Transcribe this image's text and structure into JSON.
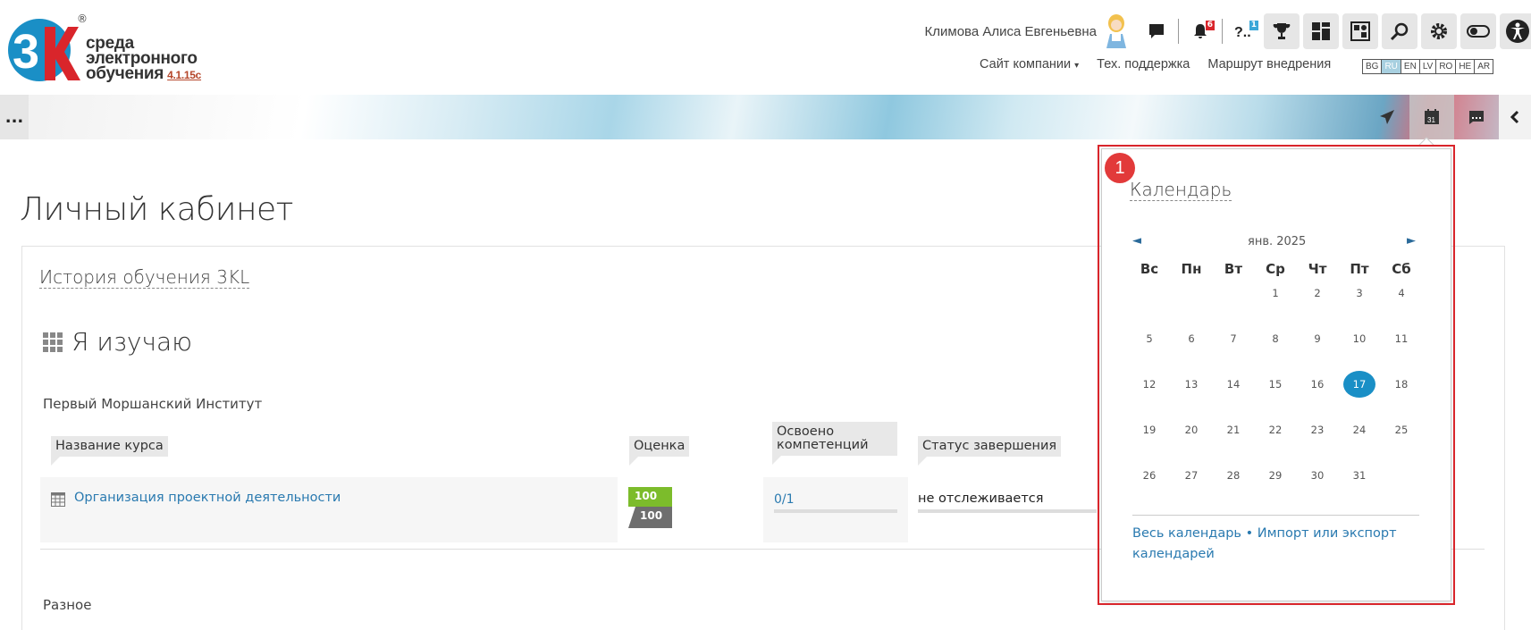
{
  "header": {
    "logo_text_line1": "среда",
    "logo_text_line2": "электронного",
    "logo_text_line3": "обучения",
    "logo_version": "4.1.15c",
    "logo_reg": "®",
    "user_name": "Климова Алиса Евгеньевна",
    "notifications_badge": "6",
    "questions_badge": "1",
    "nav_links": [
      "Сайт компании",
      "Тех. поддержка",
      "Маршрут внедрения"
    ],
    "languages": [
      "BG",
      "RU",
      "EN",
      "LV",
      "RO",
      "HE",
      "AR"
    ],
    "active_language": "RU"
  },
  "banner": {
    "more_label": "..."
  },
  "page": {
    "title": "Личный кабинет",
    "history_link": "История обучения 3KL",
    "studying_heading": "Я изучаю",
    "org_name": "Первый Моршанский Институт",
    "columns": [
      "Название курса",
      "Оценка",
      "Освоено компетенций",
      "Статус завершения"
    ],
    "course": {
      "name": "Организация проектной деятельности",
      "grade": "100",
      "grade_max": "100",
      "competencies": "0/1",
      "status": "не отслеживается"
    },
    "misc_heading": "Разное"
  },
  "calendar": {
    "marker": "1",
    "title": "Календарь",
    "month": "янв. 2025",
    "prev": "◄",
    "next": "►",
    "weekdays": [
      "Вс",
      "Пн",
      "Вт",
      "Ср",
      "Чт",
      "Пт",
      "Сб"
    ],
    "weeks": [
      [
        "",
        "",
        "",
        "1",
        "2",
        "3",
        "4"
      ],
      [
        "5",
        "6",
        "7",
        "8",
        "9",
        "10",
        "11"
      ],
      [
        "12",
        "13",
        "14",
        "15",
        "16",
        "17",
        "18"
      ],
      [
        "19",
        "20",
        "21",
        "22",
        "23",
        "24",
        "25"
      ],
      [
        "26",
        "27",
        "28",
        "29",
        "30",
        "31",
        ""
      ]
    ],
    "today": "17",
    "footer_text": "Весь календарь • Импорт или экспорт календарей"
  },
  "colors": {
    "link": "#2a7ab0",
    "accent": "#1a8fc6",
    "marker": "#e23a3a",
    "grade_pass": "#7cbc2b"
  }
}
